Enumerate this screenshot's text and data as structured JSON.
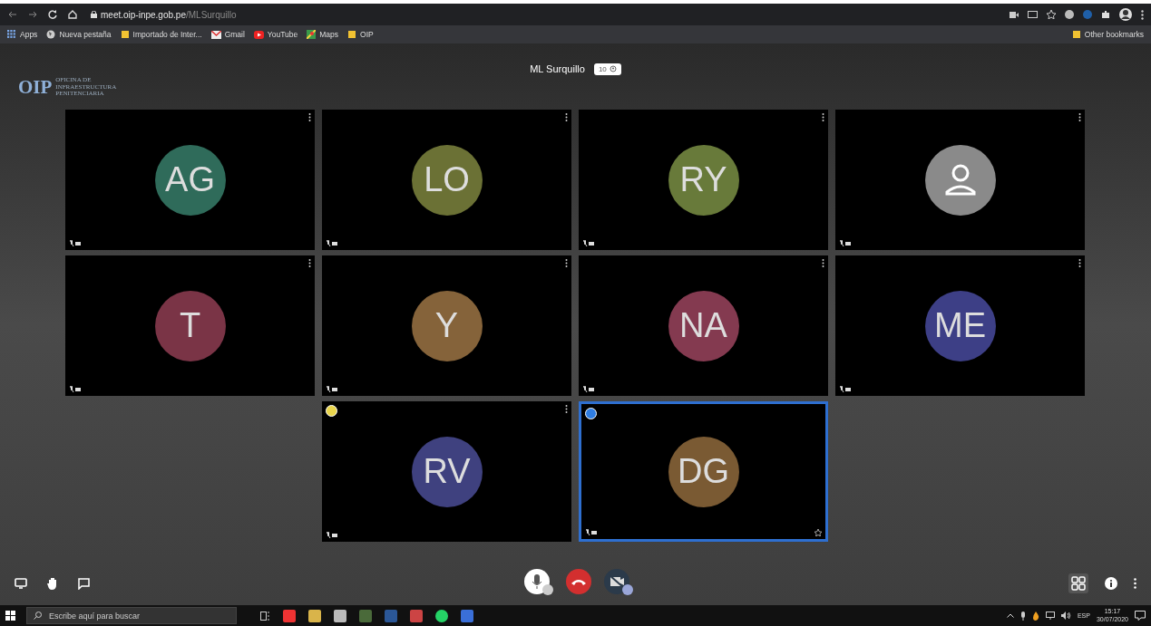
{
  "browser": {
    "url_host": "meet.oip-inpe.gob.pe",
    "url_path": "/MLSurquillo",
    "bookmarks": [
      {
        "label": "Apps",
        "kind": "apps"
      },
      {
        "label": "Nueva pestaña",
        "kind": "globe"
      },
      {
        "label": "Importado de Inter...",
        "kind": "folder"
      },
      {
        "label": "Gmail",
        "kind": "mail"
      },
      {
        "label": "YouTube",
        "kind": "video"
      },
      {
        "label": "Maps",
        "kind": "map"
      },
      {
        "label": "OIP",
        "kind": "folder"
      }
    ],
    "other_bookmarks": "Other bookmarks"
  },
  "logo": {
    "mark": "OIP",
    "lines": [
      "OFICINA DE",
      "INFRAESTRUCTURA",
      "PENITENCIARIA"
    ]
  },
  "meeting": {
    "title": "ML Surquillo",
    "participant_count": "10"
  },
  "rows": [
    [
      {
        "kind": "initials",
        "initials": "AG",
        "color": "#2f6b5a",
        "selected": false
      },
      {
        "kind": "initials",
        "initials": "LO",
        "color": "#6b7135",
        "selected": false
      },
      {
        "kind": "initials",
        "initials": "RY",
        "color": "#687a3a",
        "selected": false
      },
      {
        "kind": "silhouette",
        "color": "#8a8a8a",
        "selected": false
      }
    ],
    [
      {
        "kind": "initials",
        "initials": "T",
        "color": "#7a3446",
        "selected": false
      },
      {
        "kind": "initials",
        "initials": "Y",
        "color": "#85633a",
        "selected": false
      },
      {
        "kind": "initials",
        "initials": "NA",
        "color": "#843a50",
        "selected": false
      },
      {
        "kind": "initials",
        "initials": "ME",
        "color": "#3d3f86",
        "selected": false
      }
    ],
    [
      {
        "kind": "initials",
        "initials": "RV",
        "color": "#3f417f",
        "selected": false,
        "badge": {
          "color": "#e9d54c"
        }
      },
      {
        "kind": "initials",
        "initials": "DG",
        "color": "#7a5a33",
        "selected": true,
        "badge": {
          "color": "#2f7de1"
        }
      }
    ]
  ],
  "taskbar": {
    "search_placeholder": "Escribe aquí para buscar",
    "language": "ESP",
    "time": "15:17",
    "date": "30/07/2020"
  }
}
